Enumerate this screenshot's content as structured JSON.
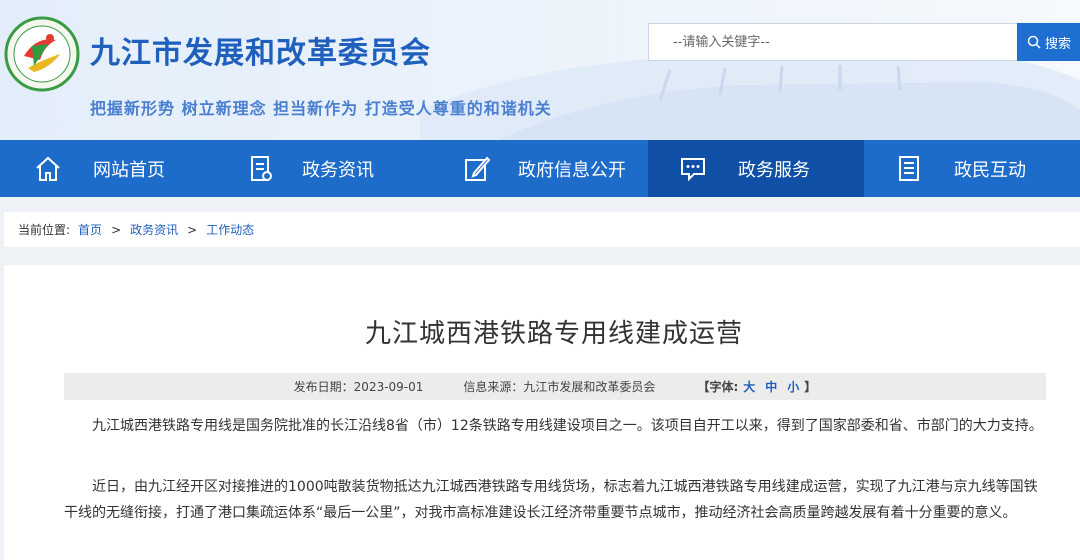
{
  "header": {
    "site_title": "九江市发展和改革委员会",
    "slogan": "把握新形势 树立新理念 担当新作为 打造受人尊重的和谐机关",
    "search": {
      "placeholder": "--请输入关键字--",
      "button_label": "搜索"
    }
  },
  "nav": {
    "items": [
      {
        "label": "网站首页",
        "icon": "home-icon"
      },
      {
        "label": "政务资讯",
        "icon": "document-icon"
      },
      {
        "label": "政府信息公开",
        "icon": "edit-icon"
      },
      {
        "label": "政务服务",
        "icon": "chat-icon",
        "active": true
      },
      {
        "label": "政民互动",
        "icon": "notes-icon"
      }
    ]
  },
  "breadcrumb": {
    "prefix": "当前位置:",
    "items": [
      "首页",
      "政务资讯",
      "工作动态"
    ],
    "separator": ">"
  },
  "article": {
    "title": "九江城西港铁路专用线建成运营",
    "publish_date": "发布日期：2023-09-01",
    "source": "信息来源：九江市发展和改革委员会",
    "font_size_label": "【字体:",
    "font_sizes": [
      "大",
      "中",
      "小"
    ],
    "font_size_close": "】",
    "paragraphs": [
      "九江城西港铁路专用线是国务院批准的长江沿线8省（市）12条铁路专用线建设项目之一。该项目自开工以来，得到了国家部委和省、市部门的大力支持。",
      "近日，由九江经开区对接推进的1000吨散装货物抵达九江城西港铁路专用线货场，标志着九江城西港铁路专用线建成运营，实现了九江港与京九线等国铁干线的无缝衔接，打通了港口集疏运体系“最后一公里”，对我市高标准建设长江经济带重要节点城市，推动经济社会高质量跨越发展有着十分重要的意义。"
    ]
  },
  "colors": {
    "brand_blue": "#1e6cc9",
    "nav_active": "#0f4fa6",
    "title_blue": "#1f5fbd"
  }
}
